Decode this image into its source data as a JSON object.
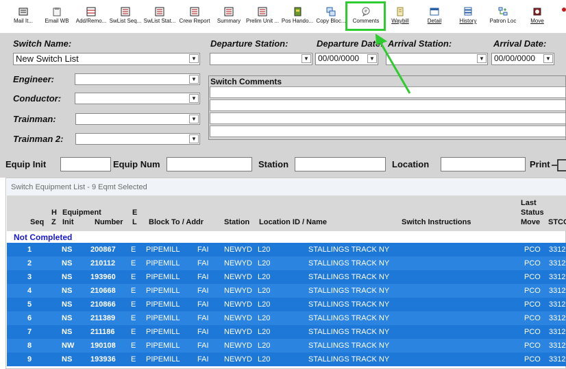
{
  "toolbar": {
    "buttons": [
      {
        "label": "Mail It..."
      },
      {
        "label": "Email WB"
      },
      {
        "label": "Add/Remo..."
      },
      {
        "label": "SwList Seq..."
      },
      {
        "label": "SwList Stat..."
      },
      {
        "label": "Crew Report"
      },
      {
        "label": "Summary"
      },
      {
        "label": "Prelim Unit ..."
      },
      {
        "label": "Pos Hando..."
      },
      {
        "label": "Copy Bloc..."
      },
      {
        "label": "Comments"
      },
      {
        "label": "Waybill"
      },
      {
        "label": "Detail"
      },
      {
        "label": "History"
      },
      {
        "label": "Patron Loc"
      },
      {
        "label": "Move"
      }
    ]
  },
  "form": {
    "switch_name_label": "Switch Name:",
    "switch_name_value": "New Switch List",
    "departure_station_label": "Departure Station:",
    "departure_date_label": "Departure Date:",
    "departure_date_value": "00/00/0000",
    "arrival_station_label": "Arrival Station:",
    "arrival_date_label": "Arrival Date:",
    "arrival_date_value": "00/00/0000",
    "engineer_label": "Engineer:",
    "conductor_label": "Conductor:",
    "trainman_label": "Trainman:",
    "trainman2_label": "Trainman 2:",
    "switch_comments_label": "Switch Comments"
  },
  "search": {
    "equip_init_label": "Equip Init",
    "equip_num_label": "Equip Num",
    "station_label": "Station",
    "location_label": "Location",
    "print_label": "Print"
  },
  "list": {
    "title": "Switch Equipment List - 9 Eqmt Selected",
    "headers": {
      "seq": "Seq",
      "hz_h": "H",
      "hz_z": "Z",
      "equipment": "Equipment",
      "init": "Init",
      "number": "Number",
      "el_e": "E",
      "el_l": "L",
      "block_to": "Block To / Addr",
      "station": "Station",
      "location": "Location ID / Name",
      "instructions": "Switch Instructions",
      "last_status_1": "Last",
      "last_status_2": "Status",
      "last_status_3": "Move",
      "stcc": "STCC"
    },
    "section_label": "Not Completed",
    "rows": [
      {
        "seq": "1",
        "init": "NS",
        "number": "200867",
        "el": "E",
        "block": "PIPEMILL",
        "addr": "FAI",
        "station": "NEWYD",
        "loc": "L20",
        "name": "STALLINGS TRACK NY",
        "move": "PCO",
        "stcc": "3312"
      },
      {
        "seq": "2",
        "init": "NS",
        "number": "210112",
        "el": "E",
        "block": "PIPEMILL",
        "addr": "FAI",
        "station": "NEWYD",
        "loc": "L20",
        "name": "STALLINGS TRACK NY",
        "move": "PCO",
        "stcc": "3312"
      },
      {
        "seq": "3",
        "init": "NS",
        "number": "193960",
        "el": "E",
        "block": "PIPEMILL",
        "addr": "FAI",
        "station": "NEWYD",
        "loc": "L20",
        "name": "STALLINGS TRACK NY",
        "move": "PCO",
        "stcc": "3312"
      },
      {
        "seq": "4",
        "init": "NS",
        "number": "210668",
        "el": "E",
        "block": "PIPEMILL",
        "addr": "FAI",
        "station": "NEWYD",
        "loc": "L20",
        "name": "STALLINGS TRACK NY",
        "move": "PCO",
        "stcc": "3312"
      },
      {
        "seq": "5",
        "init": "NS",
        "number": "210866",
        "el": "E",
        "block": "PIPEMILL",
        "addr": "FAI",
        "station": "NEWYD",
        "loc": "L20",
        "name": "STALLINGS TRACK NY",
        "move": "PCO",
        "stcc": "3312"
      },
      {
        "seq": "6",
        "init": "NS",
        "number": "211389",
        "el": "E",
        "block": "PIPEMILL",
        "addr": "FAI",
        "station": "NEWYD",
        "loc": "L20",
        "name": "STALLINGS TRACK NY",
        "move": "PCO",
        "stcc": "3312"
      },
      {
        "seq": "7",
        "init": "NS",
        "number": "211186",
        "el": "E",
        "block": "PIPEMILL",
        "addr": "FAI",
        "station": "NEWYD",
        "loc": "L20",
        "name": "STALLINGS TRACK NY",
        "move": "PCO",
        "stcc": "3312"
      },
      {
        "seq": "8",
        "init": "NW",
        "number": "190108",
        "el": "E",
        "block": "PIPEMILL",
        "addr": "FAI",
        "station": "NEWYD",
        "loc": "L20",
        "name": "STALLINGS TRACK NY",
        "move": "PCO",
        "stcc": "3312"
      },
      {
        "seq": "9",
        "init": "NS",
        "number": "193936",
        "el": "E",
        "block": "PIPEMILL",
        "addr": "FAI",
        "station": "NEWYD",
        "loc": "L20",
        "name": "STALLINGS TRACK NY",
        "move": "PCO",
        "stcc": "3312"
      }
    ]
  },
  "colors": {
    "row_selected": "#1e78d8",
    "section_text": "#1717d6",
    "highlight": "#2ecc2e"
  }
}
